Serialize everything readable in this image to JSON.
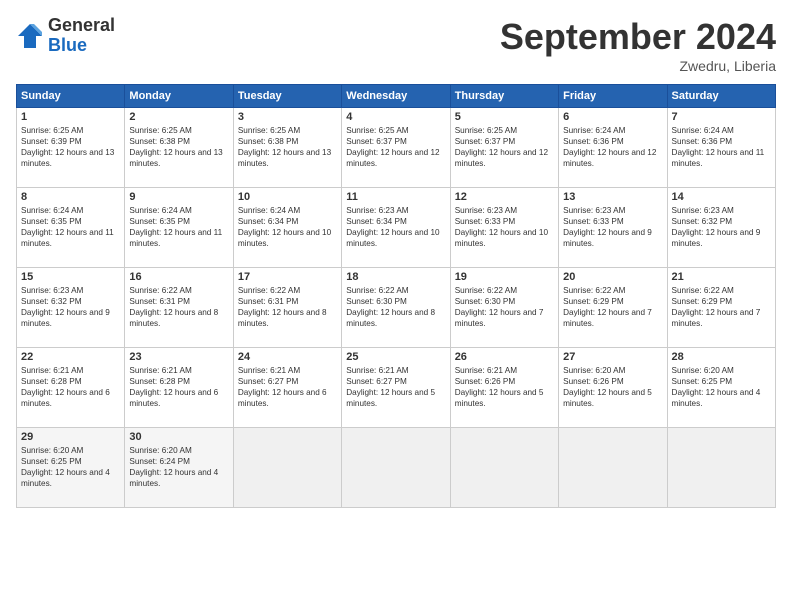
{
  "header": {
    "logo_general": "General",
    "logo_blue": "Blue",
    "month_title": "September 2024",
    "location": "Zwedru, Liberia"
  },
  "calendar": {
    "days_of_week": [
      "Sunday",
      "Monday",
      "Tuesday",
      "Wednesday",
      "Thursday",
      "Friday",
      "Saturday"
    ],
    "weeks": [
      [
        null,
        null,
        null,
        null,
        null,
        null,
        null
      ]
    ],
    "cells": [
      {
        "day": null,
        "sunrise": null,
        "sunset": null,
        "daylight": null
      },
      {
        "day": "1",
        "sunrise": "6:25 AM",
        "sunset": "6:39 PM",
        "daylight": "12 hours and 13 minutes."
      },
      {
        "day": "2",
        "sunrise": "6:25 AM",
        "sunset": "6:38 PM",
        "daylight": "12 hours and 13 minutes."
      },
      {
        "day": "3",
        "sunrise": "6:25 AM",
        "sunset": "6:38 PM",
        "daylight": "12 hours and 13 minutes."
      },
      {
        "day": "4",
        "sunrise": "6:25 AM",
        "sunset": "6:37 PM",
        "daylight": "12 hours and 12 minutes."
      },
      {
        "day": "5",
        "sunrise": "6:25 AM",
        "sunset": "6:37 PM",
        "daylight": "12 hours and 12 minutes."
      },
      {
        "day": "6",
        "sunrise": "6:24 AM",
        "sunset": "6:36 PM",
        "daylight": "12 hours and 12 minutes."
      },
      {
        "day": "7",
        "sunrise": "6:24 AM",
        "sunset": "6:36 PM",
        "daylight": "12 hours and 11 minutes."
      },
      {
        "day": "8",
        "sunrise": "6:24 AM",
        "sunset": "6:35 PM",
        "daylight": "12 hours and 11 minutes."
      },
      {
        "day": "9",
        "sunrise": "6:24 AM",
        "sunset": "6:35 PM",
        "daylight": "12 hours and 11 minutes."
      },
      {
        "day": "10",
        "sunrise": "6:24 AM",
        "sunset": "6:34 PM",
        "daylight": "12 hours and 10 minutes."
      },
      {
        "day": "11",
        "sunrise": "6:23 AM",
        "sunset": "6:34 PM",
        "daylight": "12 hours and 10 minutes."
      },
      {
        "day": "12",
        "sunrise": "6:23 AM",
        "sunset": "6:33 PM",
        "daylight": "12 hours and 10 minutes."
      },
      {
        "day": "13",
        "sunrise": "6:23 AM",
        "sunset": "6:33 PM",
        "daylight": "12 hours and 9 minutes."
      },
      {
        "day": "14",
        "sunrise": "6:23 AM",
        "sunset": "6:32 PM",
        "daylight": "12 hours and 9 minutes."
      },
      {
        "day": "15",
        "sunrise": "6:23 AM",
        "sunset": "6:32 PM",
        "daylight": "12 hours and 9 minutes."
      },
      {
        "day": "16",
        "sunrise": "6:22 AM",
        "sunset": "6:31 PM",
        "daylight": "12 hours and 8 minutes."
      },
      {
        "day": "17",
        "sunrise": "6:22 AM",
        "sunset": "6:31 PM",
        "daylight": "12 hours and 8 minutes."
      },
      {
        "day": "18",
        "sunrise": "6:22 AM",
        "sunset": "6:30 PM",
        "daylight": "12 hours and 8 minutes."
      },
      {
        "day": "19",
        "sunrise": "6:22 AM",
        "sunset": "6:30 PM",
        "daylight": "12 hours and 7 minutes."
      },
      {
        "day": "20",
        "sunrise": "6:22 AM",
        "sunset": "6:29 PM",
        "daylight": "12 hours and 7 minutes."
      },
      {
        "day": "21",
        "sunrise": "6:22 AM",
        "sunset": "6:29 PM",
        "daylight": "12 hours and 7 minutes."
      },
      {
        "day": "22",
        "sunrise": "6:21 AM",
        "sunset": "6:28 PM",
        "daylight": "12 hours and 6 minutes."
      },
      {
        "day": "23",
        "sunrise": "6:21 AM",
        "sunset": "6:28 PM",
        "daylight": "12 hours and 6 minutes."
      },
      {
        "day": "24",
        "sunrise": "6:21 AM",
        "sunset": "6:27 PM",
        "daylight": "12 hours and 6 minutes."
      },
      {
        "day": "25",
        "sunrise": "6:21 AM",
        "sunset": "6:27 PM",
        "daylight": "12 hours and 5 minutes."
      },
      {
        "day": "26",
        "sunrise": "6:21 AM",
        "sunset": "6:26 PM",
        "daylight": "12 hours and 5 minutes."
      },
      {
        "day": "27",
        "sunrise": "6:20 AM",
        "sunset": "6:26 PM",
        "daylight": "12 hours and 5 minutes."
      },
      {
        "day": "28",
        "sunrise": "6:20 AM",
        "sunset": "6:25 PM",
        "daylight": "12 hours and 4 minutes."
      },
      {
        "day": "29",
        "sunrise": "6:20 AM",
        "sunset": "6:25 PM",
        "daylight": "12 hours and 4 minutes."
      },
      {
        "day": "30",
        "sunrise": "6:20 AM",
        "sunset": "6:24 PM",
        "daylight": "12 hours and 4 minutes."
      }
    ]
  }
}
